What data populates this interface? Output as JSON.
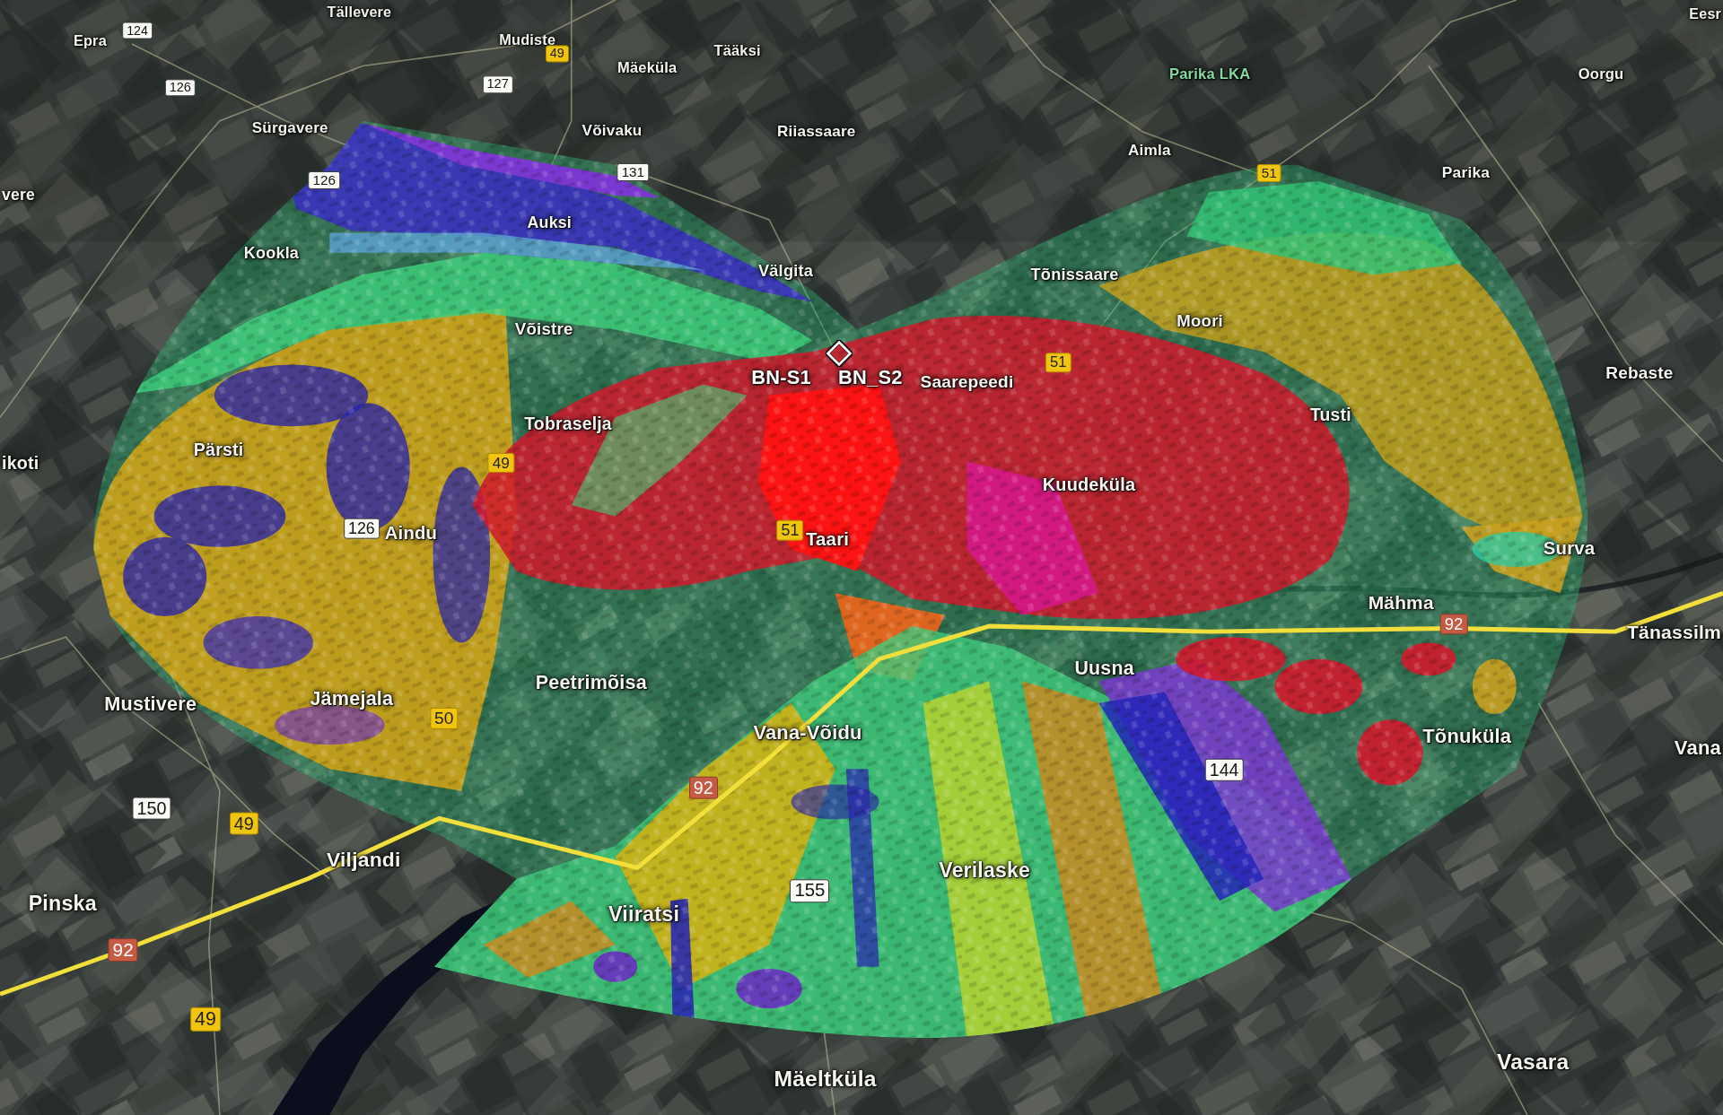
{
  "map": {
    "labels": [
      {
        "text": "Tällevere",
        "kind": "place"
      },
      {
        "text": "Eesr",
        "kind": "place"
      },
      {
        "text": "Epra",
        "kind": "place"
      },
      {
        "text": "Mudiste",
        "kind": "place"
      },
      {
        "text": "Tääksi",
        "kind": "place"
      },
      {
        "text": "Mäeküla",
        "kind": "place"
      },
      {
        "text": "Parika LKA",
        "kind": "area"
      },
      {
        "text": "Oorgu",
        "kind": "place"
      },
      {
        "text": "Sürgavere",
        "kind": "place"
      },
      {
        "text": "Võivaku",
        "kind": "place"
      },
      {
        "text": "Riiassaare",
        "kind": "place"
      },
      {
        "text": "Aimla",
        "kind": "place"
      },
      {
        "text": "Parika",
        "kind": "place"
      },
      {
        "text": "vere",
        "kind": "place"
      },
      {
        "text": "Auksi",
        "kind": "place"
      },
      {
        "text": "Kookla",
        "kind": "place"
      },
      {
        "text": "Välgita",
        "kind": "place"
      },
      {
        "text": "Tõnissaare",
        "kind": "place"
      },
      {
        "text": "Võistre",
        "kind": "place"
      },
      {
        "text": "Moori",
        "kind": "place"
      },
      {
        "text": "BN-S1",
        "kind": "site"
      },
      {
        "text": "BN_S2",
        "kind": "site"
      },
      {
        "text": "Saarepeedi",
        "kind": "place"
      },
      {
        "text": "Rebaste",
        "kind": "place"
      },
      {
        "text": "Tobraselja",
        "kind": "place"
      },
      {
        "text": "Tusti",
        "kind": "place"
      },
      {
        "text": "ikoti",
        "kind": "place"
      },
      {
        "text": "Pärsti",
        "kind": "place"
      },
      {
        "text": "Kuudeküla",
        "kind": "place"
      },
      {
        "text": "Aindu",
        "kind": "place"
      },
      {
        "text": "Taari",
        "kind": "place"
      },
      {
        "text": "Surva",
        "kind": "place"
      },
      {
        "text": "Mähma",
        "kind": "place"
      },
      {
        "text": "Tänassilm",
        "kind": "place"
      },
      {
        "text": "Mustivere",
        "kind": "place"
      },
      {
        "text": "Jämejala",
        "kind": "place"
      },
      {
        "text": "Peetrimõisa",
        "kind": "place"
      },
      {
        "text": "Uusna",
        "kind": "place"
      },
      {
        "text": "Vana-Võidu",
        "kind": "place"
      },
      {
        "text": "Tõnuküla",
        "kind": "place"
      },
      {
        "text": "Vana",
        "kind": "place"
      },
      {
        "text": "Viljandi",
        "kind": "place"
      },
      {
        "text": "Verilaske",
        "kind": "place"
      },
      {
        "text": "Pinska",
        "kind": "place"
      },
      {
        "text": "Viiratsi",
        "kind": "place"
      },
      {
        "text": "Mäeltküla",
        "kind": "place"
      },
      {
        "text": "Vasara",
        "kind": "place"
      }
    ],
    "road_signs": [
      {
        "number": "124",
        "kind": "secondary"
      },
      {
        "number": "49",
        "kind": "main"
      },
      {
        "number": "126",
        "kind": "secondary"
      },
      {
        "number": "127",
        "kind": "secondary"
      },
      {
        "number": "126",
        "kind": "secondary"
      },
      {
        "number": "131",
        "kind": "secondary"
      },
      {
        "number": "51",
        "kind": "main"
      },
      {
        "number": "51",
        "kind": "main"
      },
      {
        "number": "49",
        "kind": "main"
      },
      {
        "number": "126",
        "kind": "secondary"
      },
      {
        "number": "51",
        "kind": "main"
      },
      {
        "number": "92",
        "kind": "primary"
      },
      {
        "number": "50",
        "kind": "main"
      },
      {
        "number": "144",
        "kind": "secondary"
      },
      {
        "number": "92",
        "kind": "primary"
      },
      {
        "number": "150",
        "kind": "secondary"
      },
      {
        "number": "49",
        "kind": "main"
      },
      {
        "number": "155",
        "kind": "secondary"
      },
      {
        "number": "92",
        "kind": "primary"
      },
      {
        "number": "49",
        "kind": "main"
      }
    ]
  }
}
